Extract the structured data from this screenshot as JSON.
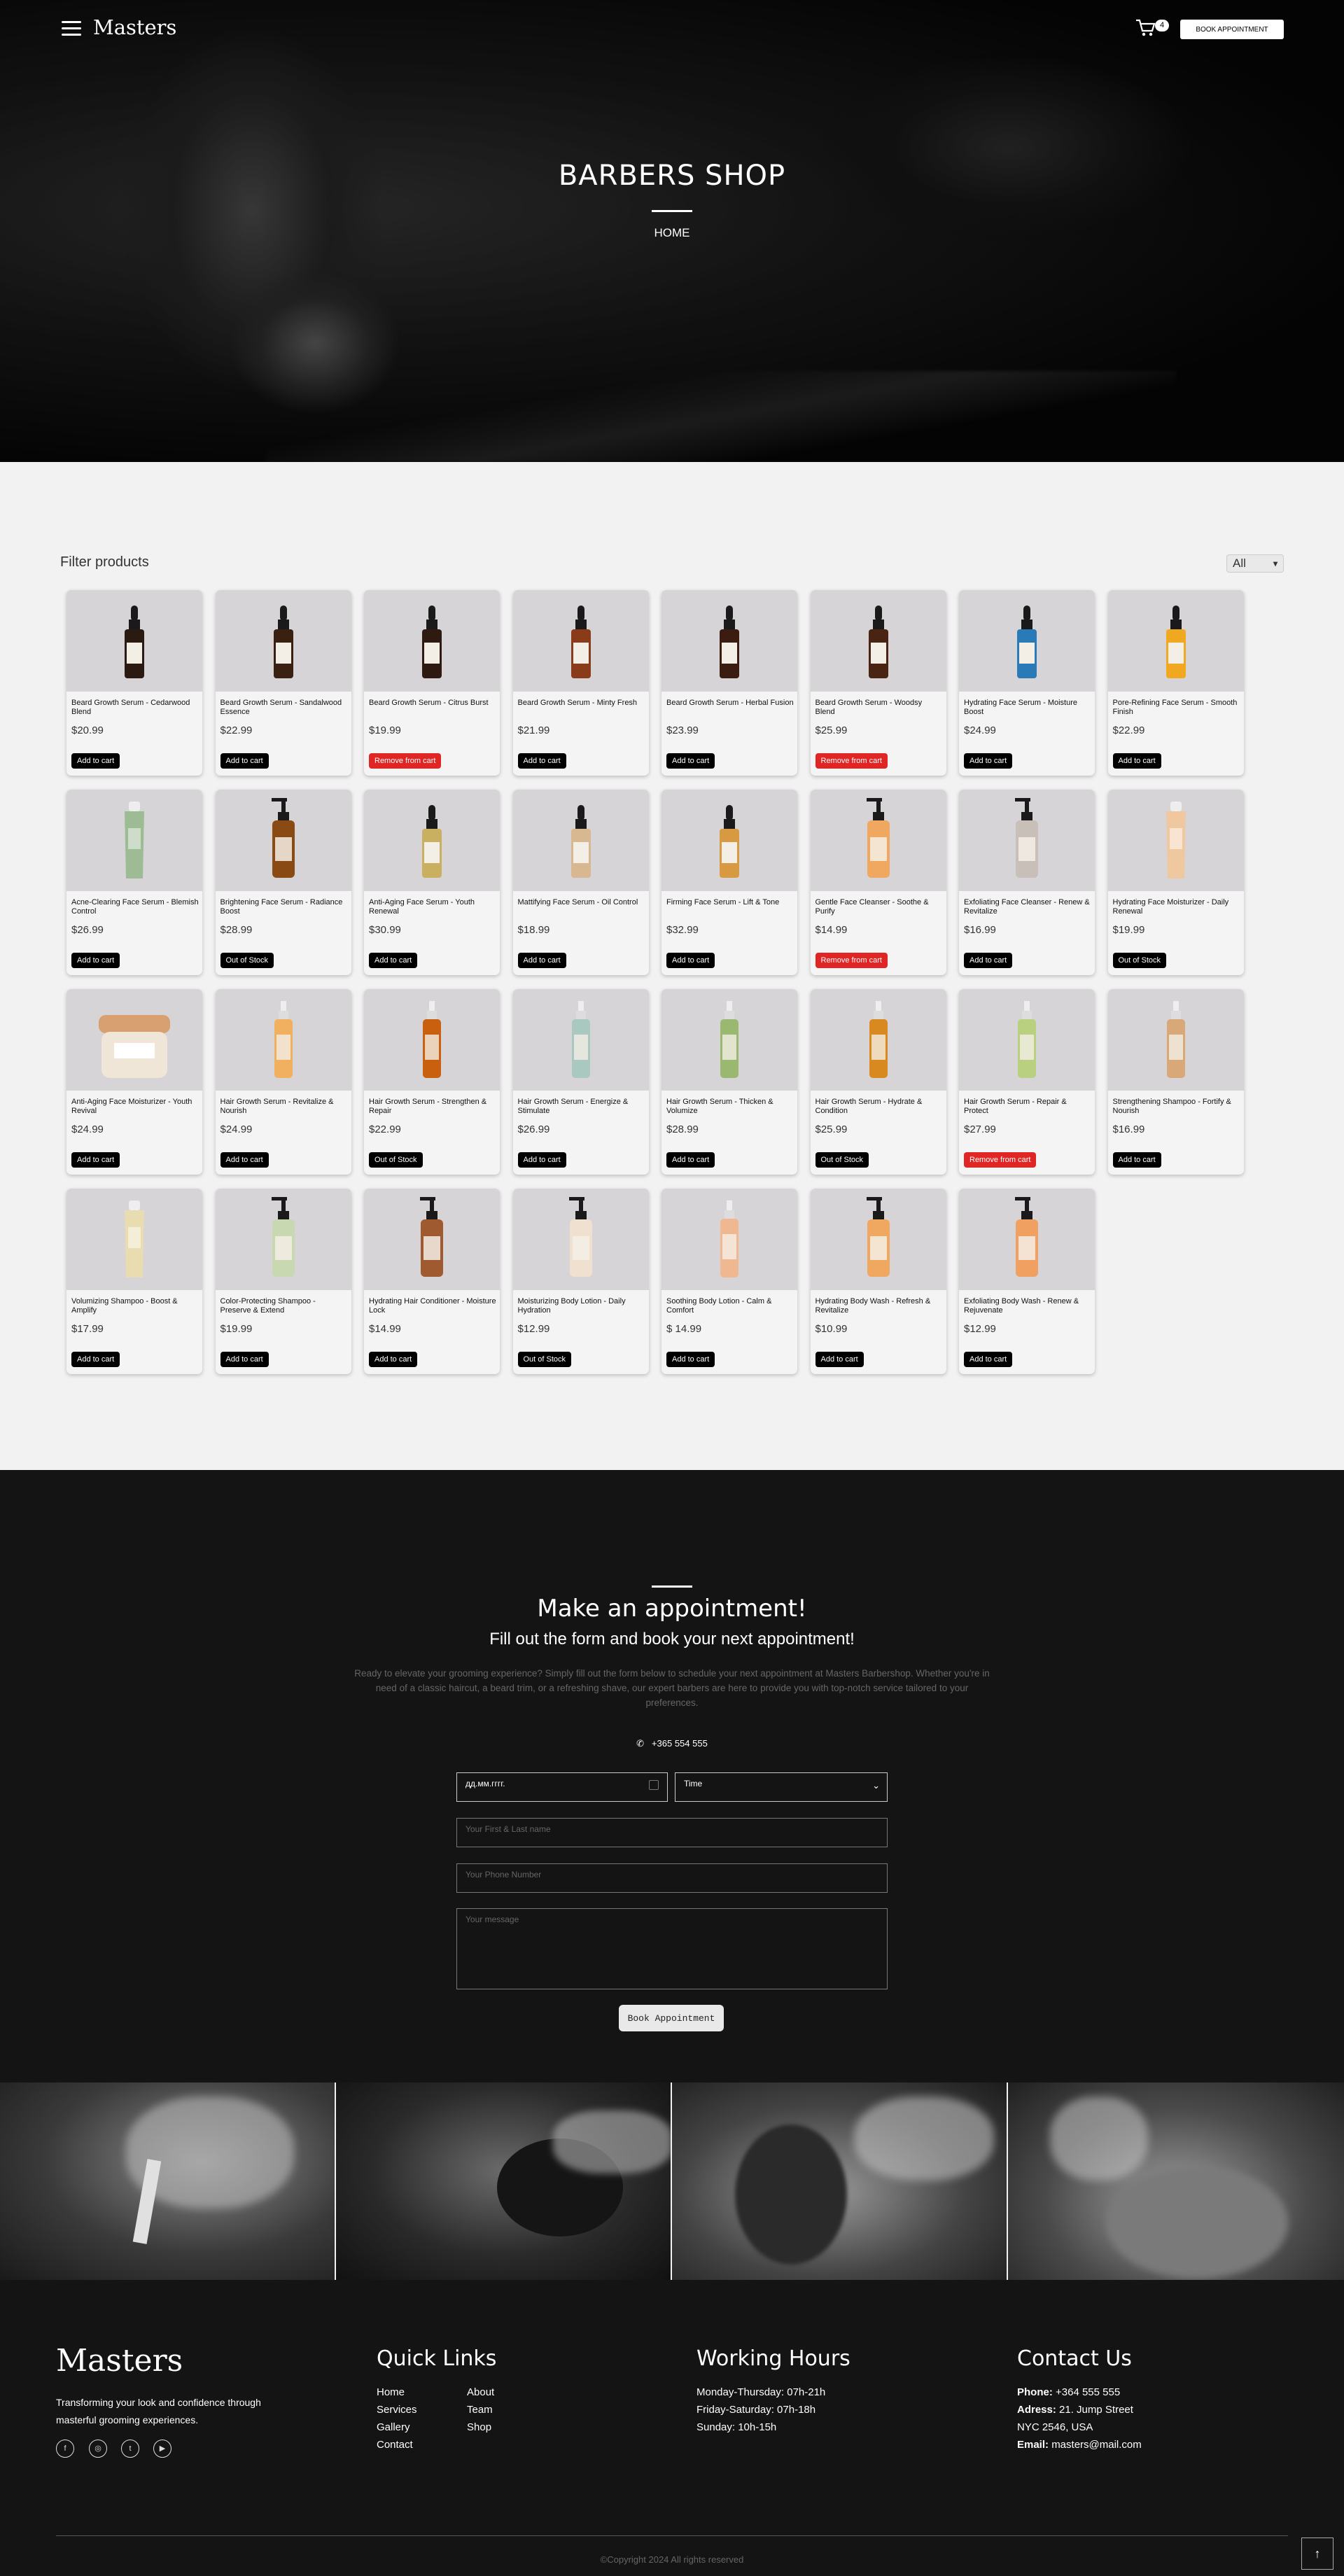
{
  "header": {
    "brand": "Masters",
    "cart_count": "4",
    "book_label": "BOOK APPOINTMENT"
  },
  "hero": {
    "title": "BARBERS SHOP",
    "breadcrumb": "HOME"
  },
  "filter": {
    "label": "Filter products",
    "selected": "All"
  },
  "products": [
    {
      "name": "Beard Growth Serum - Cedarwood Blend",
      "price": "$20.99",
      "action": "Add to cart",
      "bottle": "dropper",
      "color": "#2a1a12"
    },
    {
      "name": "Beard Growth Serum - Sandalwood Essence",
      "price": "$22.99",
      "action": "Add to cart",
      "bottle": "dropper",
      "color": "#3a2010"
    },
    {
      "name": "Beard Growth Serum - Citrus Burst",
      "price": "$19.99",
      "action": "Remove from cart",
      "bottle": "dropper",
      "color": "#2e1a10"
    },
    {
      "name": "Beard Growth Serum - Minty Fresh",
      "price": "$21.99",
      "action": "Add to cart",
      "bottle": "dropper",
      "color": "#8a3c1a"
    },
    {
      "name": "Beard Growth Serum - Herbal Fusion",
      "price": "$23.99",
      "action": "Add to cart",
      "bottle": "dropper",
      "color": "#3a1c10"
    },
    {
      "name": "Beard Growth Serum - Woodsy Blend",
      "price": "$25.99",
      "action": "Remove from cart",
      "bottle": "dropper",
      "color": "#4a2412"
    },
    {
      "name": "Hydrating Face Serum - Moisture Boost",
      "price": "$24.99",
      "action": "Add to cart",
      "bottle": "dropper",
      "color": "#2a7ab8"
    },
    {
      "name": "Pore-Refining Face Serum - Smooth Finish",
      "price": "$22.99",
      "action": "Add to cart",
      "bottle": "dropper",
      "color": "#f0a820"
    },
    {
      "name": "Acne-Clearing Face Serum - Blemish Control",
      "price": "$26.99",
      "action": "Add to cart",
      "bottle": "tube",
      "color": "#9dbb94"
    },
    {
      "name": "Brightening Face Serum - Radiance Boost",
      "price": "$28.99",
      "action": "Out of Stock",
      "bottle": "pump",
      "color": "#8a4a14"
    },
    {
      "name": "Anti-Aging Face Serum - Youth Renewal",
      "price": "$30.99",
      "action": "Add to cart",
      "bottle": "dropper",
      "color": "#c8b060"
    },
    {
      "name": "Mattifying Face Serum - Oil Control",
      "price": "$18.99",
      "action": "Add to cart",
      "bottle": "dropper",
      "color": "#d8b890"
    },
    {
      "name": "Firming Face Serum - Lift & Tone",
      "price": "$32.99",
      "action": "Add to cart",
      "bottle": "dropper",
      "color": "#d89a40"
    },
    {
      "name": "Gentle Face Cleanser - Soothe & Purify",
      "price": "$14.99",
      "action": "Remove from cart",
      "bottle": "pump",
      "color": "#f0a860"
    },
    {
      "name": "Exfoliating Face Cleanser - Renew & Revitalize",
      "price": "$16.99",
      "action": "Add to cart",
      "bottle": "pump",
      "color": "#c8c0b8"
    },
    {
      "name": "Hydrating Face Moisturizer - Daily Renewal",
      "price": "$19.99",
      "action": "Out of Stock",
      "bottle": "tube",
      "color": "#f0c8a0"
    },
    {
      "name": "Anti-Aging Face Moisturizer - Youth Revival",
      "price": "$24.99",
      "action": "Add to cart",
      "bottle": "jar",
      "color": "#d8a070"
    },
    {
      "name": "Hair Growth Serum - Revitalize & Nourish",
      "price": "$24.99",
      "action": "Add to cart",
      "bottle": "spray",
      "color": "#f0b060"
    },
    {
      "name": "Hair Growth Serum - Strengthen & Repair",
      "price": "$22.99",
      "action": "Out of Stock",
      "bottle": "spray",
      "color": "#c86010"
    },
    {
      "name": "Hair Growth Serum - Energize & Stimulate",
      "price": "$26.99",
      "action": "Add to cart",
      "bottle": "spray",
      "color": "#a8c8c0"
    },
    {
      "name": "Hair Growth Serum - Thicken & Volumize",
      "price": "$28.99",
      "action": "Add to cart",
      "bottle": "spray",
      "color": "#9ab870"
    },
    {
      "name": "Hair Growth Serum - Hydrate & Condition",
      "price": "$25.99",
      "action": "Out of Stock",
      "bottle": "spray",
      "color": "#d88a20"
    },
    {
      "name": "Hair Growth Serum - Repair & Protect",
      "price": "$27.99",
      "action": "Remove from cart",
      "bottle": "spray",
      "color": "#b8d080"
    },
    {
      "name": "Strengthening Shampoo - Fortify & Nourish",
      "price": "$16.99",
      "action": "Add to cart",
      "bottle": "spray",
      "color": "#d8a878"
    },
    {
      "name": "Volumizing Shampoo - Boost & Amplify",
      "price": "$17.99",
      "action": "Add to cart",
      "bottle": "tube",
      "color": "#e8dcb0"
    },
    {
      "name": "Color-Protecting Shampoo - Preserve & Extend",
      "price": "$19.99",
      "action": "Add to cart",
      "bottle": "pump",
      "color": "#c8d8b0"
    },
    {
      "name": "Hydrating Hair Conditioner - Moisture Lock",
      "price": "$14.99",
      "action": "Add to cart",
      "bottle": "pump",
      "color": "#a05a30"
    },
    {
      "name": "Moisturizing Body Lotion - Daily Hydration",
      "price": "$12.99",
      "action": "Out of Stock",
      "bottle": "pump",
      "color": "#f0e0d0"
    },
    {
      "name": "Soothing Body Lotion - Calm & Comfort",
      "price": "$ 14.99",
      "action": "Add to cart",
      "bottle": "spray",
      "color": "#f0b890"
    },
    {
      "name": "Hydrating Body Wash - Refresh & Revitalize",
      "price": "$10.99",
      "action": "Add to cart",
      "bottle": "pump",
      "color": "#f0a860"
    },
    {
      "name": "Exfoliating Body Wash - Renew & Rejuvenate",
      "price": "$12.99",
      "action": "Add to cart",
      "bottle": "pump",
      "color": "#f0a060"
    }
  ],
  "appointment": {
    "title": "Make an appointment!",
    "subtitle": "Fill out the form and book your next appointment!",
    "description": "Ready to elevate your grooming experience? Simply fill out the form below to schedule your next appointment at Masters Barbershop. Whether you're in need of a classic haircut, a beard trim, or a refreshing shave, our expert barbers are here to provide you with top-notch service tailored to your preferences.",
    "phone": "+365 554 555",
    "date_value": "дд.мм.гггг.",
    "time_value": "Time",
    "name_placeholder": "Your First & Last name",
    "phone_placeholder": "Your Phone Number",
    "message_placeholder": "Your message",
    "button": "Book Appointment"
  },
  "footer": {
    "brand": "Masters",
    "tagline": "Transforming your look and confidence through masterful grooming experiences.",
    "quick_links_title": "Quick Links",
    "links_col1": [
      "Home",
      "Services",
      "Gallery",
      "Contact"
    ],
    "links_col2": [
      "About",
      "Team",
      "Shop"
    ],
    "hours_title": "Working Hours",
    "hours": [
      "Monday-Thursday: 07h-21h",
      "Friday-Saturday: 07h-18h",
      "Sunday: 10h-15h"
    ],
    "contact_title": "Contact Us",
    "phone_label": "Phone:",
    "phone": "+364 555 555",
    "address_label": "Adress:",
    "address": "21. Jump Street",
    "city": "NYC 2546, USA",
    "email_label": "Email:",
    "email": "masters@mail.com",
    "copyright": "©Copyright 2024 All rights reserved"
  }
}
